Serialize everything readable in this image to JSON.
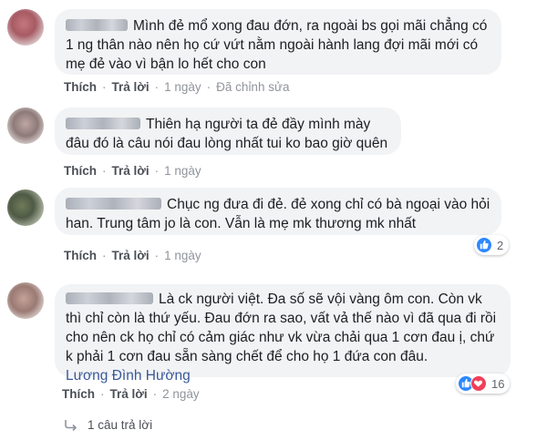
{
  "comments": [
    {
      "text": "Mình đẻ mổ xong đau đớn, ra ngoài bs gọi mãi chẳng có 1 ng thân nào nên họ cứ vứt nằm ngoài hành lang đợi mãi mới có mẹ đẻ vào vì bận lo hết cho con",
      "like_label": "Thích",
      "reply_label": "Trả lời",
      "time": "1 ngày",
      "edited": "Đã chỉnh sửa"
    },
    {
      "text": "Thiên hạ người ta đẻ đầy mình mày đâu đó là câu nói đau lòng nhất tui ko bao giờ quên",
      "like_label": "Thích",
      "reply_label": "Trả lời",
      "time": "1 ngày"
    },
    {
      "text": "Chục ng đưa đi đẻ. đẻ xong chỉ có bà ngoại vào hỏi han. Trung tâm jo là con. Vẫn là mẹ mk thương mk nhất",
      "like_label": "Thích",
      "reply_label": "Trả lời",
      "time": "1 ngày",
      "reaction_count": "2"
    },
    {
      "text": "Là ck người việt. Đa số sẽ vội vàng ôm con. Còn vk thì chỉ còn là thứ yếu. Đau đớn ra sao, vất vả thế nào vì đã qua đi rồi cho nên ck họ chỉ có cảm giác như vk vừa chải qua 1 cơn đau ị, chứ k phải 1 cơn đau sẵn sàng chết để cho họ 1 đứa con đâu.",
      "signature": "Lương Đình Hường",
      "like_label": "Thích",
      "reply_label": "Trả lời",
      "time": "2 ngày",
      "reaction_count": "16",
      "replies_label": "1 câu trả lời"
    }
  ],
  "colors": {
    "bubble": "#f2f3f5",
    "link": "#385898",
    "like": "#2d88ff",
    "heart": "#f33e58"
  }
}
